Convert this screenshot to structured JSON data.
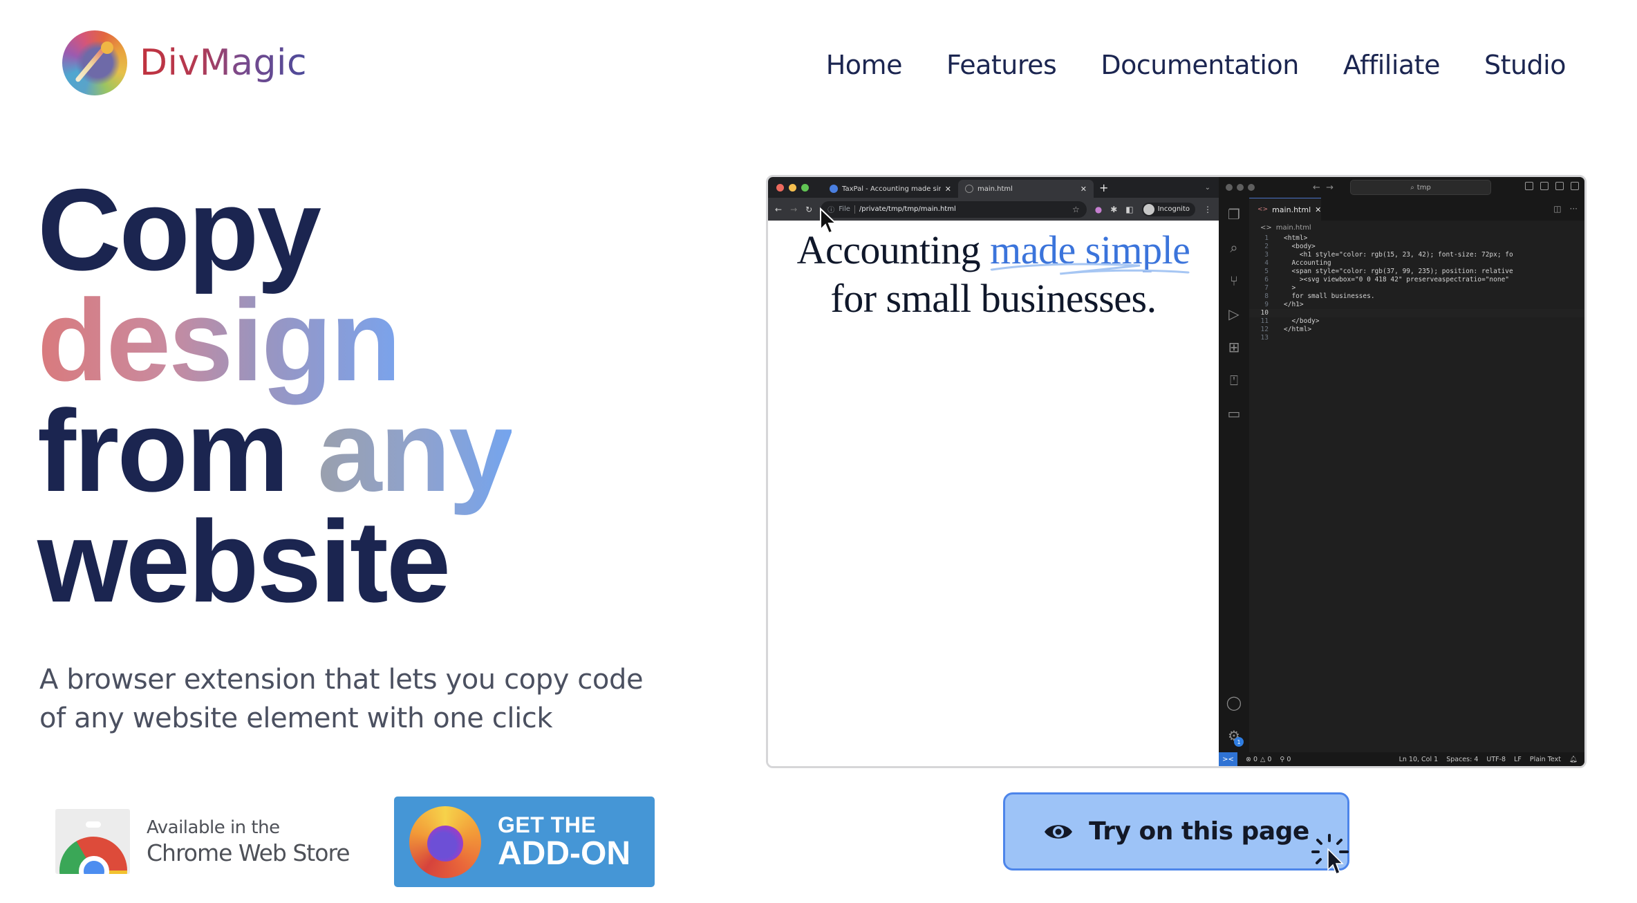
{
  "header": {
    "brand": "DivMagic",
    "logo_icon": "magic-wand-circle-logo",
    "nav": [
      {
        "label": "Home"
      },
      {
        "label": "Features"
      },
      {
        "label": "Documentation"
      },
      {
        "label": "Affiliate"
      },
      {
        "label": "Studio"
      }
    ]
  },
  "hero": {
    "headline": {
      "line1": "Copy",
      "line2_gradient": "design",
      "line3_plain": "from ",
      "line3_gradient": "any",
      "line4": "website"
    },
    "subtitle": "A browser extension that lets you copy code of any website element with one click",
    "chrome_badge": {
      "line1": "Available in the",
      "line2": "Chrome Web Store",
      "icon": "chrome-web-store-icon"
    },
    "firefox_badge": {
      "line1": "GET THE",
      "line2": "ADD-ON",
      "icon": "firefox-icon"
    },
    "colors": {
      "text_dark": "#1b2550",
      "design_gradient": [
        "#d97a7d",
        "#7aa3ec"
      ],
      "any_gradient": [
        "#9aa0ad",
        "#74a4ee"
      ],
      "firefox_blue": "#4596d6",
      "try_button_bg": "#9dc3f7",
      "try_button_border": "#4d85ea"
    }
  },
  "demo": {
    "browser": {
      "tabs": [
        {
          "title": "TaxPal - Accounting made sim",
          "active": false
        },
        {
          "title": "main.html",
          "active": true
        }
      ],
      "new_tab": "+",
      "omnibox": {
        "scheme": "File",
        "url": "/private/tmp/tmp/main.html"
      },
      "profile": "Incognito",
      "page": {
        "plain_start": "Accounting ",
        "highlight": "made simple",
        "plain_end": "for small businesses.",
        "highlight_color": "#3b74db"
      }
    },
    "vscode": {
      "search": "tmp",
      "tab": "main.html",
      "breadcrumb": "main.html",
      "code_lines": [
        {
          "n": "1",
          "text": "<html>"
        },
        {
          "n": "2",
          "text": "  <body>"
        },
        {
          "n": "3",
          "text": "    <h1 style=\"color: rgb(15, 23, 42); font-size: 72px; fo"
        },
        {
          "n": "4",
          "text": "  Accounting"
        },
        {
          "n": "5",
          "text": "  <span style=\"color: rgb(37, 99, 235); position: relative"
        },
        {
          "n": "6",
          "text": "    ><svg viewbox=\"0 0 418 42\" preserveaspectratio=\"none\""
        },
        {
          "n": "7",
          "text": "  >"
        },
        {
          "n": "8",
          "text": "  for small businesses."
        },
        {
          "n": "9",
          "text": "</h1>"
        },
        {
          "n": "10",
          "text": ""
        },
        {
          "n": "11",
          "text": "  </body>"
        },
        {
          "n": "12",
          "text": "</html>"
        },
        {
          "n": "13",
          "text": ""
        }
      ],
      "current_line": "10",
      "settings_badge": "1",
      "status": {
        "errors": "⊗ 0",
        "warnings": "△ 0",
        "ports": "0",
        "position": "Ln 10, Col 1",
        "spaces": "Spaces: 4",
        "encoding": "UTF-8",
        "eol": "LF",
        "language": "Plain Text"
      }
    }
  },
  "try_button": {
    "label": "Try on this page",
    "icon": "eye-icon"
  }
}
